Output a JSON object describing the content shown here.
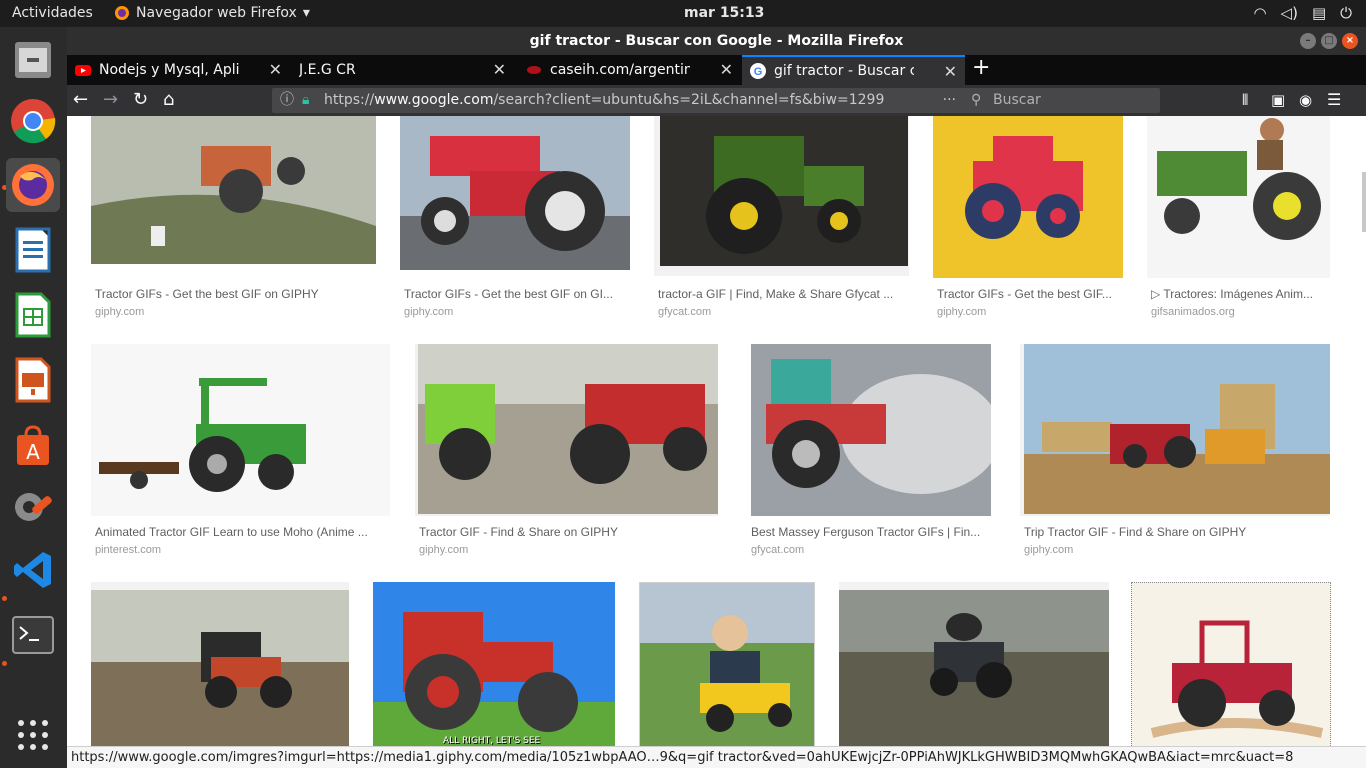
{
  "topbar": {
    "activities": "Actividades",
    "app_name": "Navegador web Firefox",
    "clock": "mar 15:13",
    "tray_icons": [
      "wifi-icon",
      "volume-icon",
      "clipboard-icon",
      "power-icon"
    ]
  },
  "dock": {
    "items": [
      "files",
      "chrome",
      "firefox",
      "writer",
      "calc",
      "impress",
      "software",
      "settings",
      "vscode",
      "terminal",
      "apps-grid"
    ]
  },
  "window": {
    "title": "gif tractor - Buscar con Google - Mozilla Firefox"
  },
  "tabs": [
    {
      "label": "Nodejs y Mysql, Aplicaci",
      "favicon": "youtube-icon"
    },
    {
      "label": "J.E.G CR",
      "favicon": "none"
    },
    {
      "label": "caseih.com/argentina/es",
      "favicon": "caseih-icon"
    },
    {
      "label": "gif tractor - Buscar con G",
      "favicon": "google-icon"
    }
  ],
  "navbar": {
    "url_scheme": "https://",
    "url_host": "www.google.com",
    "url_rest": "/search?client=ubuntu&hs=2iL&channel=fs&biw=1299",
    "search_placeholder": "Buscar"
  },
  "results": [
    {
      "title": "Tractor GIFs - Get the best GIF on GIPHY",
      "site": "giphy.com"
    },
    {
      "title": "Tractor GIFs - Get the best GIF on GI...",
      "site": "giphy.com"
    },
    {
      "title": "tractor-a GIF | Find, Make & Share Gfycat ...",
      "site": "gfycat.com"
    },
    {
      "title": "Tractor GIFs - Get the best GIF...",
      "site": "giphy.com"
    },
    {
      "title": "▷ Tractores: Imágenes Anim...",
      "site": "gifsanimados.org"
    },
    {
      "title": "Animated Tractor GIF Learn to use Moho (Anime ...",
      "site": "pinterest.com"
    },
    {
      "title": "Tractor GIF - Find & Share on GIPHY",
      "site": "giphy.com"
    },
    {
      "title": "Best Massey Ferguson Tractor GIFs | Fin...",
      "site": "gfycat.com"
    },
    {
      "title": "Trip Tractor GIF - Find & Share on GIPHY",
      "site": "giphy.com"
    },
    {
      "title": "",
      "site": ""
    },
    {
      "title": "",
      "site": ""
    },
    {
      "title": "",
      "site": ""
    },
    {
      "title": "",
      "site": ""
    },
    {
      "title": "",
      "site": ""
    }
  ],
  "image_captions": {
    "simpsons": "ALL RIGHT, LET'S SEE"
  },
  "statusbar": "https://www.google.com/imgres?imgurl=https://media1.giphy.com/media/105z1wbpAAO…9&q=gif tractor&ved=0ahUKEwjcjZr-0PPiAhWJKLkGHWBID3MQMwhGKAQwBA&iact=mrc&uact=8"
}
